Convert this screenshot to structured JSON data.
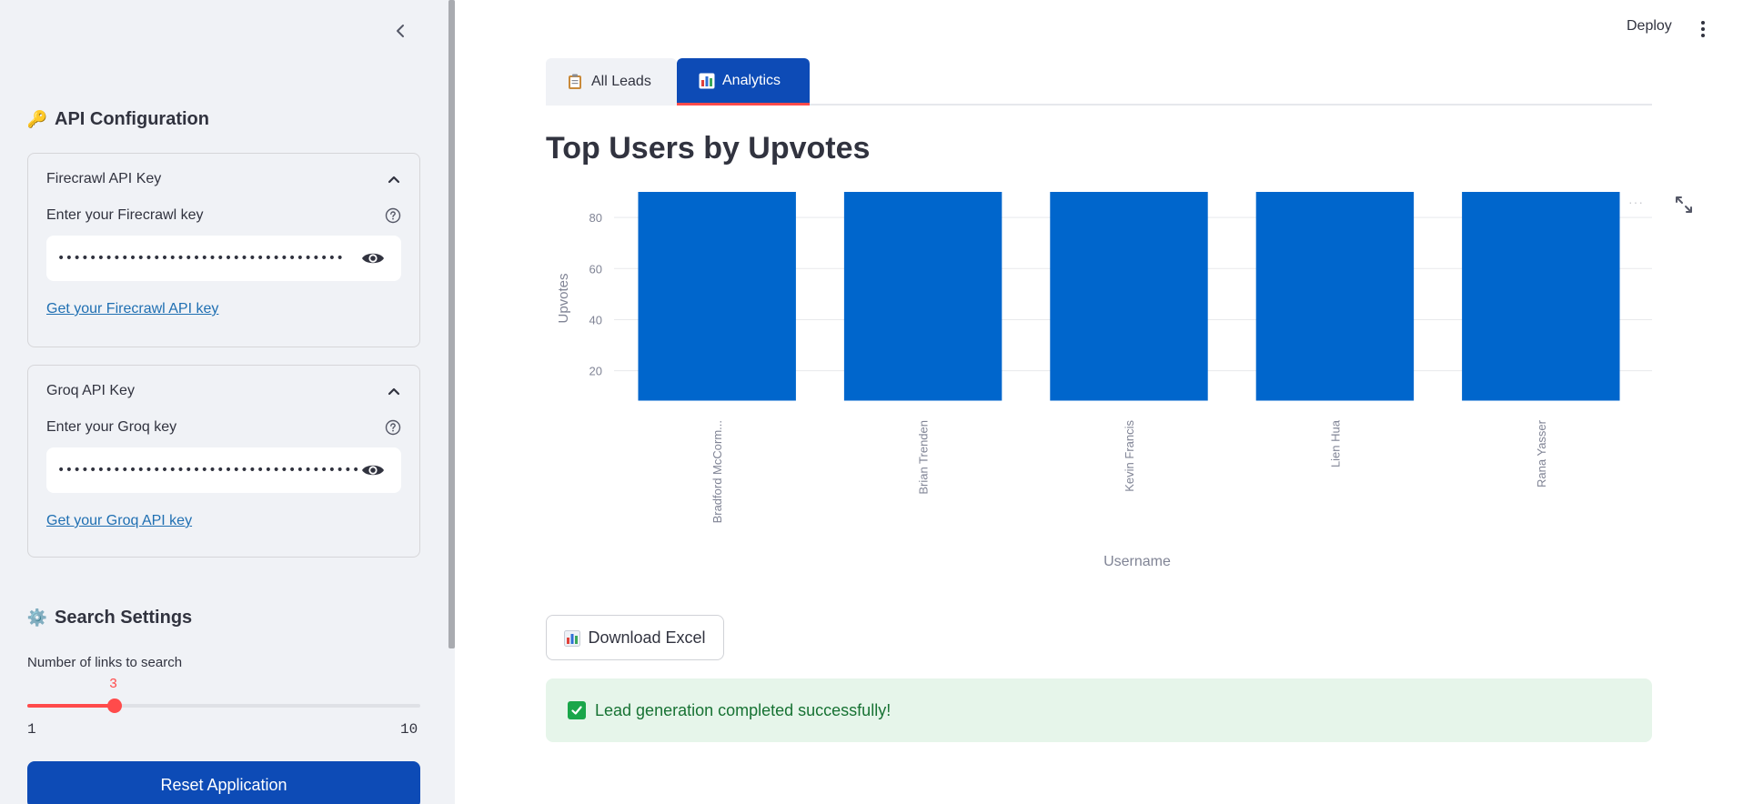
{
  "sidebar": {
    "api_section": {
      "emoji": "🔑",
      "title": "API Configuration"
    },
    "firecrawl": {
      "header": "Firecrawl API Key",
      "label": "Enter your Firecrawl key",
      "masked_value": "••••••••••••••••••••••••••••••••••••",
      "link": "Get your Firecrawl API key"
    },
    "groq": {
      "header": "Groq API Key",
      "label": "Enter your Groq key",
      "masked_value": "••••••••••••••••••••••••••••••••••••••••••••••••••••••",
      "link": "Get your Groq API key"
    },
    "search_section": {
      "emoji": "⚙️",
      "title": "Search Settings"
    },
    "slider": {
      "label": "Number of links to search",
      "value": "3",
      "min": "1",
      "max": "10",
      "fraction": 0.222
    },
    "reset_button": "Reset Application"
  },
  "header": {
    "deploy": "Deploy"
  },
  "tabs": [
    {
      "label": "All Leads",
      "active": false
    },
    {
      "label": "Analytics",
      "active": true
    }
  ],
  "page_title": "Top Users by Upvotes",
  "chart_data": {
    "type": "bar",
    "title": "",
    "xlabel": "Username",
    "ylabel": "Upvotes",
    "categories": [
      "Bradford McCorm...",
      "Brian Trenden",
      "Kevin Francis",
      "Lien Hua",
      "Rana Yasser"
    ],
    "values": [
      90,
      90,
      90,
      90,
      90
    ],
    "ylim": [
      8.5,
      90
    ],
    "yticks": [
      20,
      40,
      60,
      80
    ],
    "bar_color": "#0066cc",
    "grid": true
  },
  "download_button": "Download Excel",
  "success_message": "Lead generation completed successfully!"
}
